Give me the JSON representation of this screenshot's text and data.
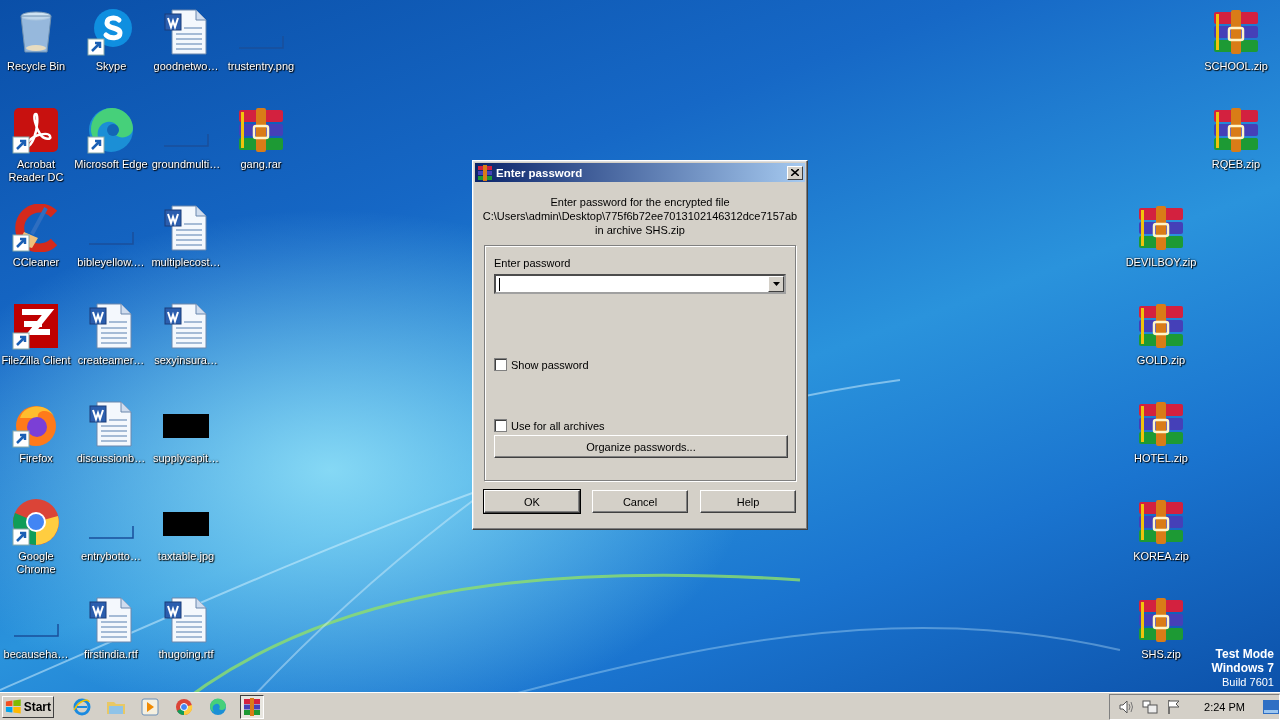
{
  "desktop_icons": [
    {
      "label": "Recycle Bin",
      "kind": "recycle",
      "shortcut": false
    },
    {
      "label": "Skype",
      "kind": "skype",
      "shortcut": true
    },
    {
      "label": "goodnetwo…",
      "kind": "word",
      "shortcut": false
    },
    {
      "label": "trustentry.png",
      "kind": "blank",
      "shortcut": false
    },
    {
      "label": "Acrobat Reader DC",
      "kind": "acrobat",
      "shortcut": true
    },
    {
      "label": "Microsoft Edge",
      "kind": "edge",
      "shortcut": true
    },
    {
      "label": "groundmulti…",
      "kind": "blank",
      "shortcut": false
    },
    {
      "label": "gang.rar",
      "kind": "rar",
      "shortcut": false
    },
    {
      "label": "CCleaner",
      "kind": "ccleaner",
      "shortcut": true
    },
    {
      "label": "bibleyellow.…",
      "kind": "blank",
      "shortcut": false
    },
    {
      "label": "multiplecost…",
      "kind": "word",
      "shortcut": false
    },
    {
      "label": "FileZilla Client",
      "kind": "filezilla",
      "shortcut": true
    },
    {
      "label": "createamer…",
      "kind": "word",
      "shortcut": false
    },
    {
      "label": "sexyinsura…",
      "kind": "word",
      "shortcut": false
    },
    {
      "label": "Firefox",
      "kind": "firefox",
      "shortcut": true
    },
    {
      "label": "discussionb…",
      "kind": "word",
      "shortcut": false
    },
    {
      "label": "supplycapit…",
      "kind": "black",
      "shortcut": false
    },
    {
      "label": "Google Chrome",
      "kind": "chrome",
      "shortcut": true
    },
    {
      "label": "entrybotto…",
      "kind": "blank",
      "shortcut": false
    },
    {
      "label": "taxtable.jpg",
      "kind": "black",
      "shortcut": false
    },
    {
      "label": "becauseha…",
      "kind": "blank",
      "shortcut": false
    },
    {
      "label": "firstindia.rtf",
      "kind": "word",
      "shortcut": false
    },
    {
      "label": "thugoing.rtf",
      "kind": "word",
      "shortcut": false
    },
    {
      "label": "SCHOOL.zip",
      "kind": "rar",
      "shortcut": false
    },
    {
      "label": "RQEB.zip",
      "kind": "rar",
      "shortcut": false
    },
    {
      "label": "DEVILBOY.zip",
      "kind": "rar",
      "shortcut": false
    },
    {
      "label": "GOLD.zip",
      "kind": "rar",
      "shortcut": false
    },
    {
      "label": "HOTEL.zip",
      "kind": "rar",
      "shortcut": false
    },
    {
      "label": "KOREA.zip",
      "kind": "rar",
      "shortcut": false
    },
    {
      "label": "SHS.zip",
      "kind": "rar",
      "shortcut": false
    }
  ],
  "dialog": {
    "title": "Enter password",
    "message": [
      "Enter password for the encrypted file",
      "C:\\Users\\admin\\Desktop\\775f6b72ee7013102146312dce7157ab",
      "in archive SHS.zip"
    ],
    "password_label": "Enter password",
    "password_focused": true,
    "checkboxes": [
      {
        "label": "Show password",
        "checked": false
      },
      {
        "label": "Use for all archives",
        "checked": false
      }
    ],
    "organize_button": "Organize passwords...",
    "buttons": [
      {
        "label": "OK",
        "default": true
      },
      {
        "label": "Cancel",
        "default": false
      },
      {
        "label": "Help",
        "default": false
      }
    ]
  },
  "watermark_text": [
    "Test Mode",
    "Windows 7",
    "Build 7601"
  ],
  "taskbar": {
    "start": "Start",
    "apps": [
      {
        "kind": "ie",
        "active": false
      },
      {
        "kind": "explorer",
        "active": false
      },
      {
        "kind": "media",
        "active": false
      },
      {
        "kind": "chrome",
        "active": false
      },
      {
        "kind": "edge",
        "active": false
      },
      {
        "kind": "rar",
        "active": true
      }
    ],
    "clock": "2:24 PM"
  }
}
